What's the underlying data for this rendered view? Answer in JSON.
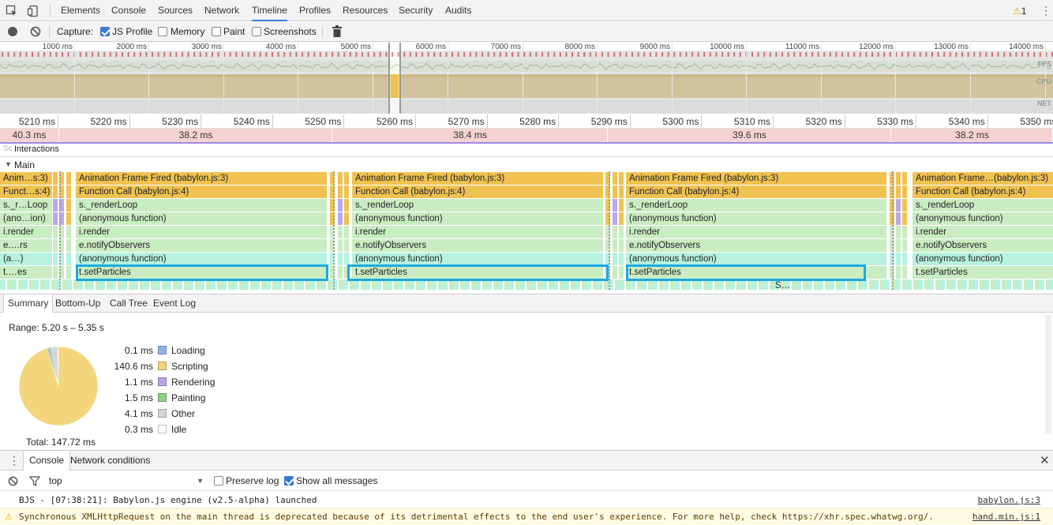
{
  "tabs": [
    "Elements",
    "Console",
    "Sources",
    "Network",
    "Timeline",
    "Profiles",
    "Resources",
    "Security",
    "Audits"
  ],
  "active_tab": "Timeline",
  "warning_count": "1",
  "toolbar": {
    "capture_label": "Capture:",
    "js_profile": "JS Profile",
    "memory": "Memory",
    "paint": "Paint",
    "screenshots": "Screenshots",
    "js_profile_checked": true
  },
  "overview": {
    "ticks": [
      "1000 ms",
      "2000 ms",
      "3000 ms",
      "4000 ms",
      "5000 ms",
      "6000 ms",
      "7000 ms",
      "8000 ms",
      "9000 ms",
      "10000 ms",
      "11000 ms",
      "12000 ms",
      "13000 ms",
      "14000 ms"
    ],
    "fps_label": "FPS",
    "cpu_label": "CPU",
    "net_label": "NET"
  },
  "ruler": {
    "ticks": [
      "5210 ms",
      "5220 ms",
      "5230 ms",
      "5240 ms",
      "5250 ms",
      "5260 ms",
      "5270 ms",
      "5280 ms",
      "5290 ms",
      "5300 ms",
      "5310 ms",
      "5320 ms",
      "5330 ms",
      "5340 ms",
      "5350 ms"
    ]
  },
  "frames": [
    "40.3 ms",
    "38.2 ms",
    "38.4 ms",
    "39.6 ms",
    "38.2 ms"
  ],
  "interactions_label": "Interactions",
  "main_label": "Main",
  "flame": {
    "col0": [
      "Anim…s:3)",
      "Funct…s:4)",
      "s._r…Loop",
      "(ano…ion)",
      "i.render",
      "e.…rs",
      "(a…)",
      "t.…es"
    ],
    "col1": [
      "Animation Frame Fired (babylon.js:3)",
      "Function Call (babylon.js:4)",
      "s._renderLoop",
      "(anonymous function)",
      "i.render",
      "e.notifyObservers",
      "(anonymous function)",
      "t.setParticles"
    ],
    "col2": [
      "Animation Frame Fired (babylon.js:3)",
      "Function Call (babylon.js:4)",
      "s._renderLoop",
      "(anonymous function)",
      "i.render",
      "e.notifyObservers",
      "(anonymous function)",
      "t.setParticles"
    ],
    "col3": [
      "Animation Frame Fired (babylon.js:3)",
      "Function Call (babylon.js:4)",
      "s._renderLoop",
      "(anonymous function)",
      "i.render",
      "e.notifyObservers",
      "(anonymous function)",
      "t.setParticles"
    ],
    "col4": [
      "Animation Frame…(babylon.js:3)",
      "Function Call (babylon.js:4)",
      "s._renderLoop",
      "(anonymous function)",
      "i.render",
      "e.notifyObservers",
      "(anonymous function)",
      "t.setParticles"
    ],
    "extra": "S…"
  },
  "detail_tabs": [
    "Summary",
    "Bottom-Up",
    "Call Tree",
    "Event Log"
  ],
  "summary": {
    "range": "Range: 5.20 s – 5.35 s",
    "total": "Total: 147.72 ms",
    "items": [
      {
        "value": "0.1 ms",
        "label": "Loading",
        "color": "#8fb5e8",
        "ms": 0.1
      },
      {
        "value": "140.6 ms",
        "label": "Scripting",
        "color": "#f3d57c",
        "ms": 140.6
      },
      {
        "value": "1.1 ms",
        "label": "Rendering",
        "color": "#b6a3ea",
        "ms": 1.1
      },
      {
        "value": "1.5 ms",
        "label": "Painting",
        "color": "#8fcf86",
        "ms": 1.5
      },
      {
        "value": "4.1 ms",
        "label": "Other",
        "color": "#d6d6d6",
        "ms": 4.1
      },
      {
        "value": "0.3 ms",
        "label": "Idle",
        "color": "#ffffff",
        "ms": 0.3
      }
    ]
  },
  "drawer": {
    "tabs": [
      "Console",
      "Network conditions"
    ],
    "filter_value": "top",
    "preserve_log": "Preserve log",
    "show_all": "Show all messages",
    "messages": [
      {
        "text": "BJS - [07:38:21]: Babylon.js engine (v2.5-alpha) launched",
        "source": "babylon.js:3",
        "level": "log"
      },
      {
        "text": "Synchronous XMLHttpRequest on the main thread is deprecated because of its detrimental effects to the end user's experience. For more help, check https://xhr.spec.whatwg.org/.",
        "source": "hand.min.js:1",
        "level": "warning"
      }
    ]
  }
}
